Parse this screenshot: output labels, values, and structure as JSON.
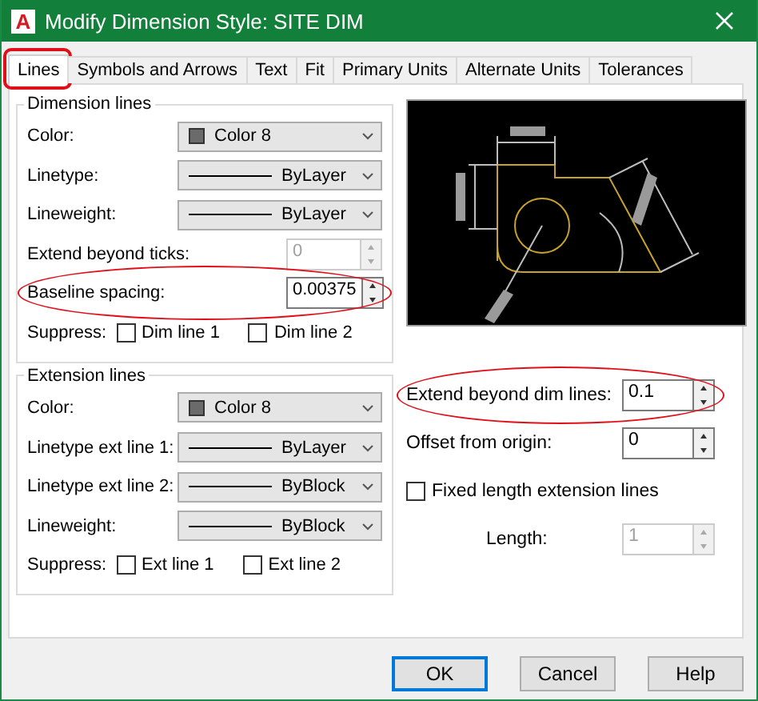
{
  "window": {
    "app_icon": "A",
    "title": "Modify Dimension Style: SITE DIM"
  },
  "tabs": [
    {
      "label": "Lines",
      "selected": true,
      "highlighted": true
    },
    {
      "label": "Symbols and Arrows",
      "selected": false,
      "highlighted": false
    },
    {
      "label": "Text",
      "selected": false,
      "highlighted": false
    },
    {
      "label": "Fit",
      "selected": false,
      "highlighted": false
    },
    {
      "label": "Primary Units",
      "selected": false,
      "highlighted": false
    },
    {
      "label": "Alternate Units",
      "selected": false,
      "highlighted": false
    },
    {
      "label": "Tolerances",
      "selected": false,
      "highlighted": false
    }
  ],
  "dimension_lines": {
    "title": "Dimension lines",
    "rows": [
      {
        "kind": "color_dropdown",
        "label": "Color:",
        "value": "Color 8"
      },
      {
        "kind": "line_dropdown",
        "label": "Linetype:",
        "value": "ByLayer"
      },
      {
        "kind": "line_dropdown",
        "label": "Lineweight:",
        "value": "ByLayer"
      },
      {
        "kind": "spinner",
        "label": "Extend beyond ticks:",
        "value": "0",
        "disabled": true,
        "highlighted": false
      },
      {
        "kind": "spinner",
        "label": "Baseline spacing:",
        "value": "0.00375",
        "disabled": false,
        "highlighted": true
      },
      {
        "kind": "checkboxes",
        "label": "Suppress:",
        "options": [
          {
            "label": "Dim line 1",
            "checked": false
          },
          {
            "label": "Dim line 2",
            "checked": false
          }
        ]
      }
    ]
  },
  "extension_lines": {
    "title": "Extension lines",
    "rows": [
      {
        "kind": "color_dropdown",
        "label": "Color:",
        "value": "Color 8"
      },
      {
        "kind": "line_dropdown",
        "label": "Linetype ext line 1:",
        "value": "ByLayer"
      },
      {
        "kind": "line_dropdown",
        "label": "Linetype ext line 2:",
        "value": "ByBlock"
      },
      {
        "kind": "line_dropdown",
        "label": "Lineweight:",
        "value": "ByBlock"
      },
      {
        "kind": "checkboxes",
        "label": "Suppress:",
        "options": [
          {
            "label": "Ext line 1",
            "checked": false
          },
          {
            "label": "Ext line 2",
            "checked": false
          }
        ]
      }
    ]
  },
  "extension_options": [
    {
      "kind": "spinner",
      "label": "Extend beyond dim lines:",
      "value": "0.1",
      "disabled": false,
      "highlighted": true
    },
    {
      "kind": "spinner",
      "label": "Offset from origin:",
      "value": "0",
      "disabled": false,
      "highlighted": false
    },
    {
      "kind": "checkbox",
      "label": "Fixed length extension lines",
      "checked": false
    },
    {
      "kind": "indented_spinner",
      "label": "Length:",
      "value": "1",
      "disabled": true,
      "highlighted": false
    }
  ],
  "buttons": [
    {
      "label": "OK",
      "default": true
    },
    {
      "label": "Cancel",
      "default": false
    },
    {
      "label": "Help",
      "default": false
    }
  ]
}
